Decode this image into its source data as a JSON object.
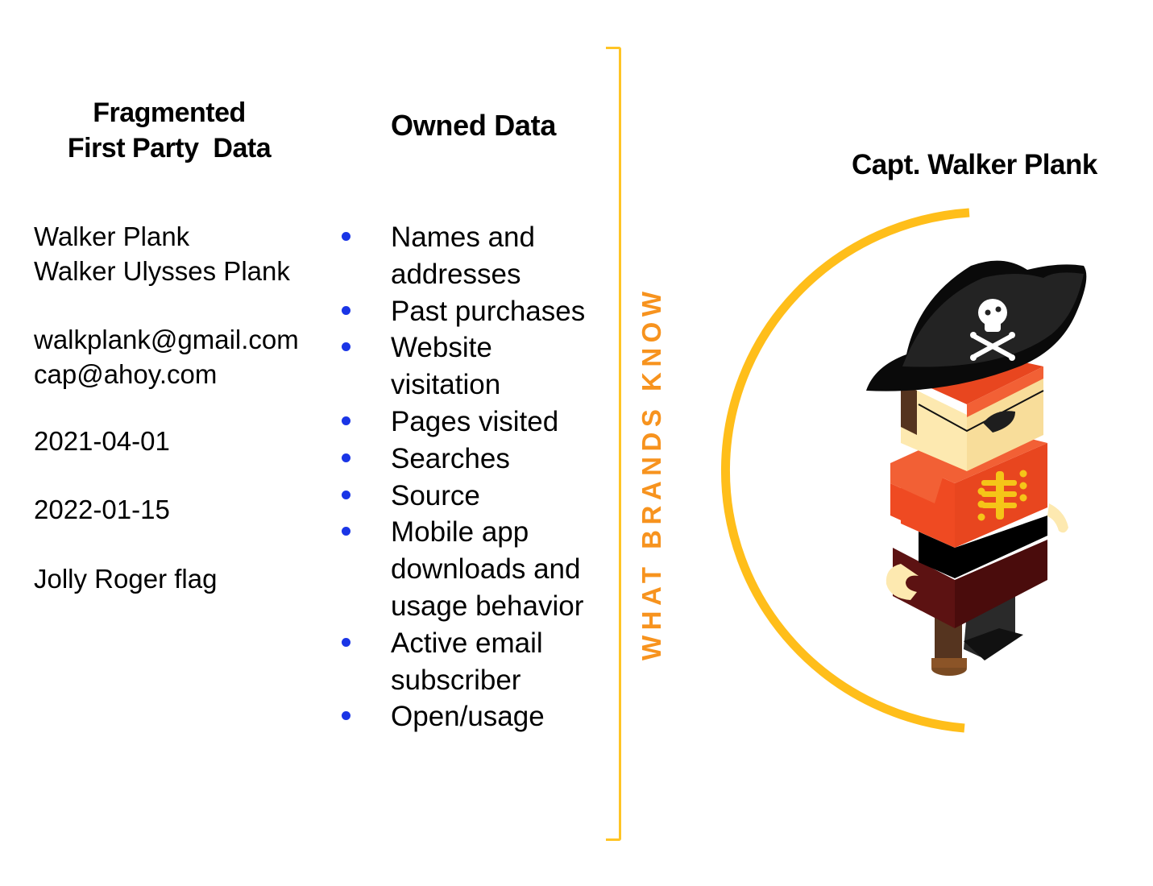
{
  "columns": {
    "fragmented": {
      "title_line1": "Fragmented",
      "title_line2": "First Party  Data",
      "groups": [
        [
          "Walker Plank",
          "Walker Ulysses Plank"
        ],
        [
          "walkplank@gmail.com",
          "cap@ahoy.com"
        ],
        [
          "2021-04-01"
        ],
        [
          "2022-01-15"
        ],
        [
          "Jolly Roger flag"
        ]
      ]
    },
    "owned": {
      "title": "Owned Data",
      "items": [
        [
          "Names and",
          "addresses"
        ],
        [
          "Past purchases"
        ],
        [
          "Website",
          "visitation"
        ],
        [
          "Pages visited"
        ],
        [
          "Searches"
        ],
        [
          "Source"
        ],
        [
          "Mobile app",
          "downloads and",
          "usage behavior"
        ],
        [
          "Active email",
          "subscriber"
        ],
        [
          "Open/usage"
        ]
      ]
    }
  },
  "divider_label": "WHAT BRANDS KNOW",
  "persona": {
    "name": "Capt. Walker Plank",
    "illustration": "pirate-character"
  },
  "colors": {
    "bullet": "#1a35e6",
    "bracket": "#ffc425",
    "divider_label": "#f7931e",
    "arc": "#ffbe1a"
  }
}
